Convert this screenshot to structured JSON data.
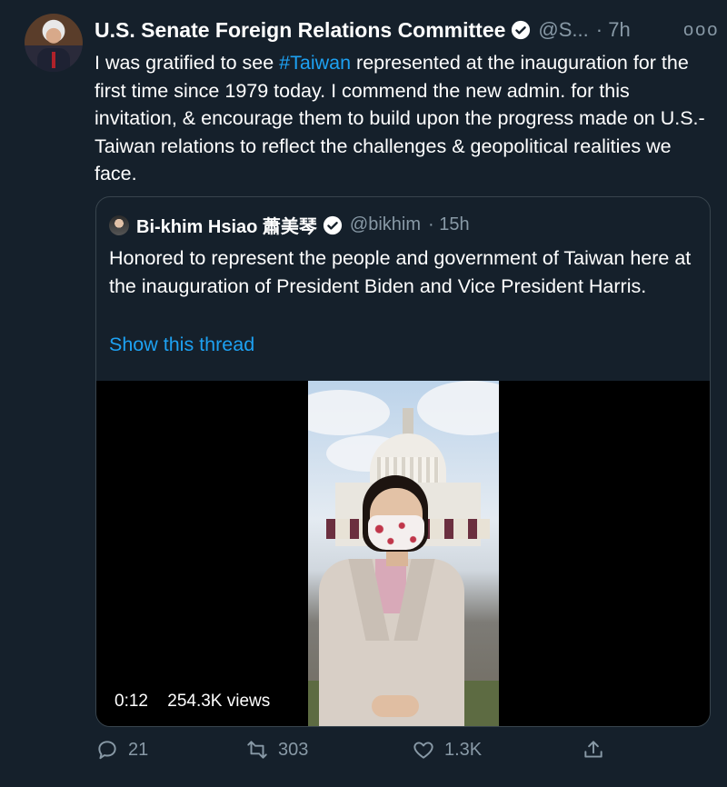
{
  "tweet": {
    "author_name": "U.S. Senate Foreign Relations Committee",
    "handle": "@S...",
    "time": "· 7h",
    "more": "ooo",
    "text_before": "I was gratified to see ",
    "hashtag": "#Taiwan",
    "text_after": " represented at the inauguration for the first time since 1979 today. I commend the new admin. for this invitation, & encourage them to build upon the progress made on U.S.-Taiwan relations to reflect the challenges & geopolitical realities we face."
  },
  "quote": {
    "author_name": "Bi-khim Hsiao 蕭美琴",
    "handle": "@bikhim",
    "time": "· 15h",
    "text": "Honored to represent the people and government of Taiwan here at the inauguration of President Biden and Vice President Harris.",
    "show_thread": "Show this thread",
    "video": {
      "duration": "0:12",
      "views": "254.3K views"
    }
  },
  "actions": {
    "reply_count": "21",
    "retweet_count": "303",
    "like_count": "1.3K"
  },
  "colors": {
    "background": "#15202b",
    "link": "#1da1f2",
    "muted": "#8899a6",
    "border": "#38444d"
  }
}
